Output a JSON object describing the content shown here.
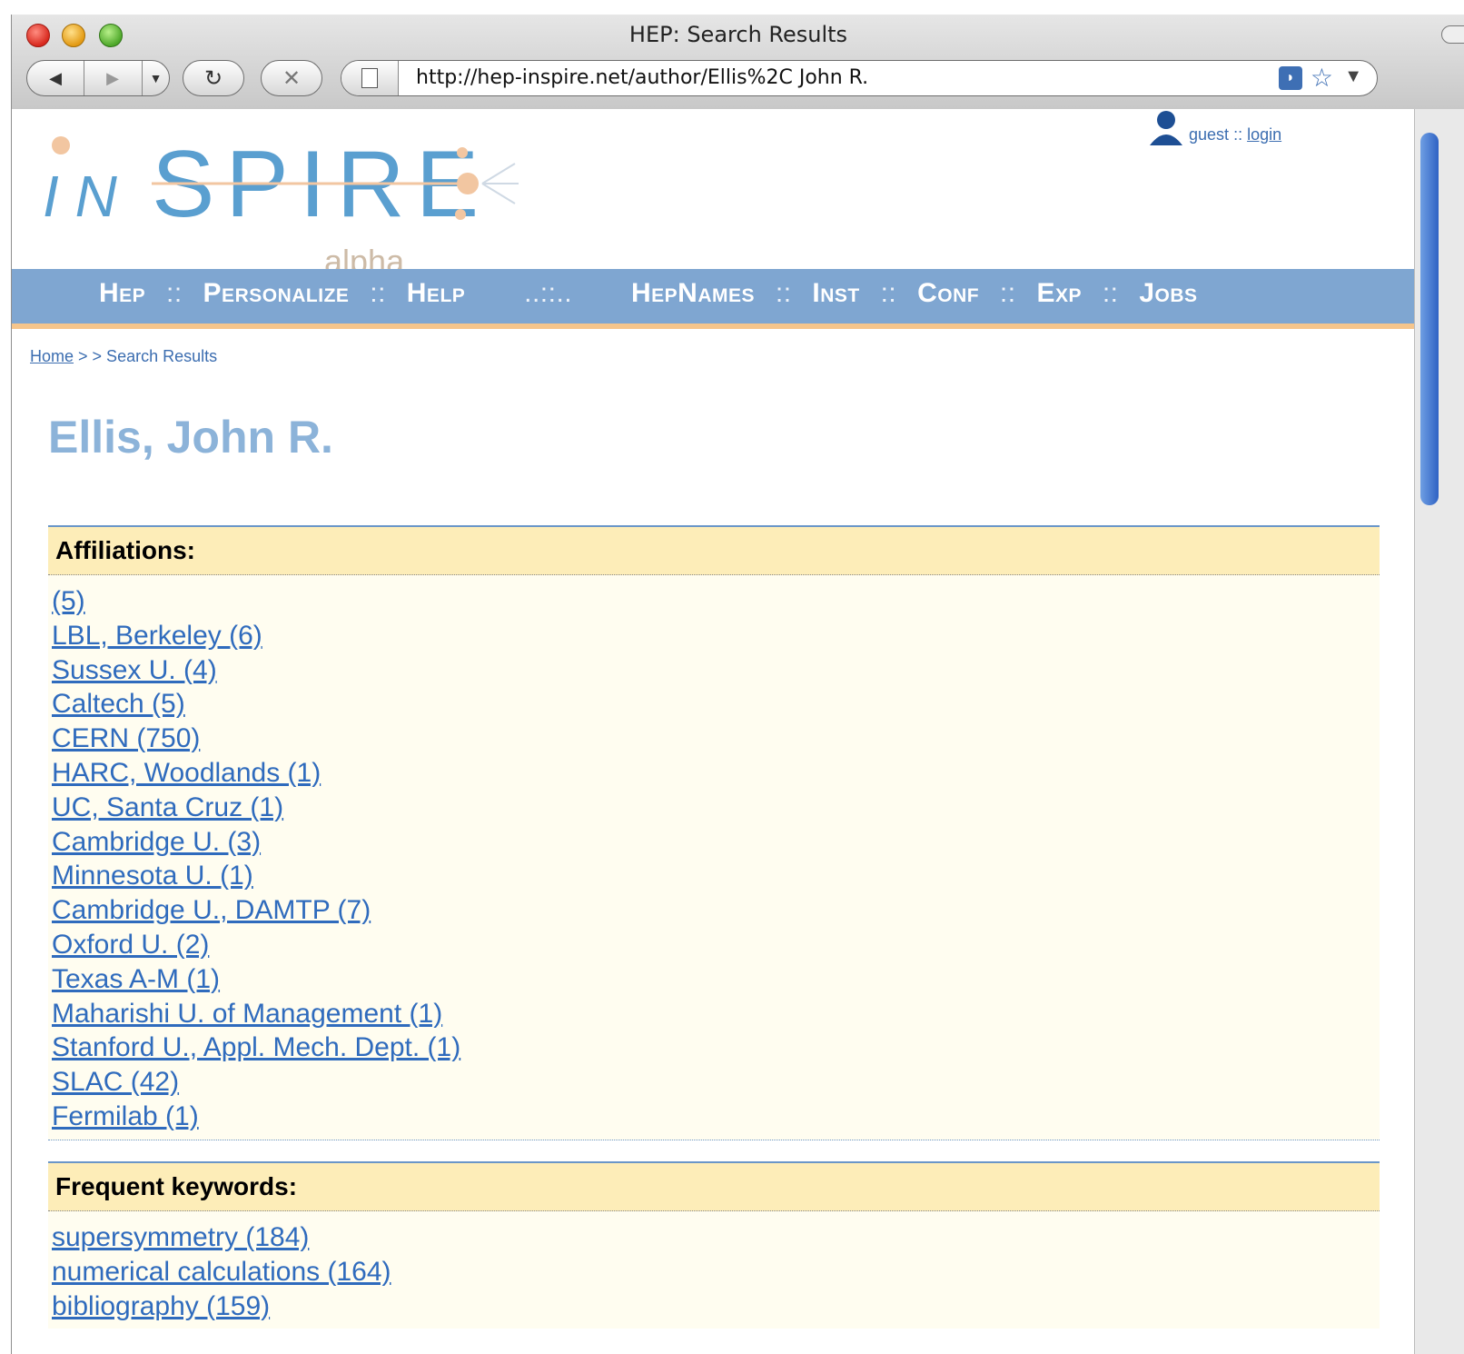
{
  "window": {
    "title": "HEP: Search Results",
    "url": "http://hep-inspire.net/author/Ellis%2C John R."
  },
  "toolbar": {
    "back_icon": "back-arrow-icon",
    "forward_icon": "forward-arrow-icon",
    "reload_icon": "reload-icon",
    "stop_icon": "stop-icon"
  },
  "logo": {
    "text": "INSPIRE",
    "subtitle": "alpha"
  },
  "user": {
    "guest": "guest",
    "separator": "::",
    "login": "login"
  },
  "nav": {
    "items": [
      "Hep",
      "Personalize",
      "Help",
      "HepNames",
      "Inst",
      "Conf",
      "Exp",
      "Jobs"
    ],
    "separator": "::",
    "divider": "..::.."
  },
  "breadcrumb": {
    "home": "Home",
    "rest": "> > Search Results"
  },
  "author": {
    "name": "Ellis, John R."
  },
  "affiliations": {
    "heading": "Affiliations:",
    "items": [
      "(5)",
      "LBL, Berkeley (6)",
      "Sussex U. (4)",
      "Caltech (5)",
      "CERN (750)",
      "HARC, Woodlands (1)",
      "UC, Santa Cruz (1)",
      "Cambridge U. (3)",
      "Minnesota U. (1)",
      "Cambridge U., DAMTP (7)",
      "Oxford U. (2)",
      "Texas A-M (1)",
      "Maharishi U. of Management (1)",
      "Stanford U., Appl. Mech. Dept. (1)",
      "SLAC (42)",
      "Fermilab (1)"
    ]
  },
  "keywords": {
    "heading": "Frequent keywords:",
    "items": [
      "supersymmetry (184)",
      "numerical calculations (164)",
      "bibliography (159)"
    ]
  },
  "colors": {
    "navbar": "#7fa6d1",
    "navbar_accent": "#f5c58c",
    "link": "#2f6bbd",
    "author_name": "#8cb3d9",
    "box_head": "#fdedb8",
    "box_body": "#fffdf0"
  }
}
